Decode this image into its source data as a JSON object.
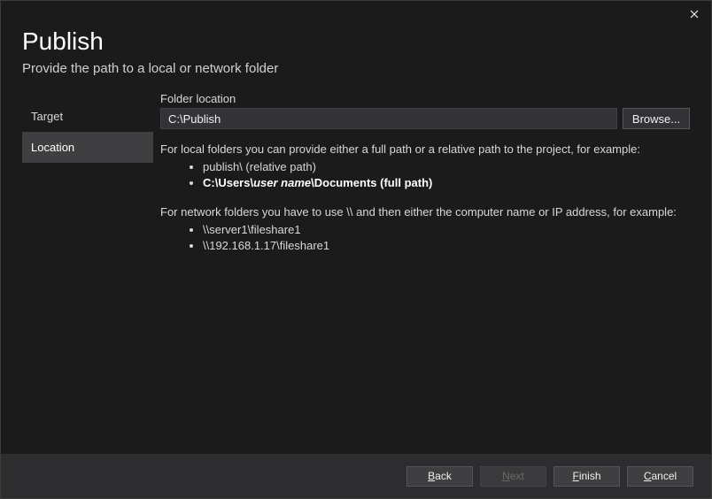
{
  "window": {
    "title": "Publish",
    "subtitle": "Provide the path to a local or network folder"
  },
  "sidebar": {
    "steps": [
      {
        "label": "Target",
        "active": false
      },
      {
        "label": "Location",
        "active": true
      }
    ]
  },
  "main": {
    "field_label": "Folder location",
    "path_value": "C:\\Publish",
    "browse_label": "Browse...",
    "help_local_intro": "For local folders you can provide either a full path or a relative path to the project, for example:",
    "help_local_examples": {
      "relative": "publish\\ (relative path)",
      "full_prefix": "C:\\Users\\",
      "full_italic": "user name",
      "full_suffix": "\\Documents (full path)"
    },
    "help_network_intro": "For network folders you have to use \\\\ and then either the computer name or IP address, for example:",
    "help_network_examples": [
      "\\\\server1\\fileshare1",
      "\\\\192.168.1.17\\fileshare1"
    ]
  },
  "footer": {
    "back": "Back",
    "next": "Next",
    "finish": "Finish",
    "cancel": "Cancel",
    "back_accel": "B",
    "next_accel": "N",
    "finish_accel": "F",
    "cancel_accel": "C"
  }
}
